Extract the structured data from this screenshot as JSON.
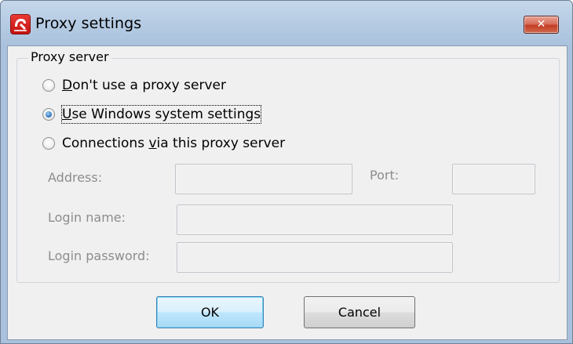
{
  "window": {
    "title": "Proxy settings",
    "close_glyph": "✕",
    "app_icon": "avira-umbrella-icon"
  },
  "group": {
    "legend": "Proxy server"
  },
  "options": {
    "no_proxy": {
      "mnemonic": "D",
      "rest": "on't use a proxy server",
      "checked": false
    },
    "windows_settings": {
      "mnemonic": "U",
      "rest": "se Windows system settings",
      "checked": true
    },
    "via_proxy": {
      "before": "Connections ",
      "mnemonic": "v",
      "rest": "ia this proxy server",
      "checked": false
    }
  },
  "fields": {
    "address_label": "Address:",
    "address_value": "",
    "port_label": "Port:",
    "port_value": "",
    "login_name_label": "Login name:",
    "login_name_value": "",
    "login_password_label": "Login password:",
    "login_password_value": ""
  },
  "buttons": {
    "ok": "OK",
    "cancel": "Cancel"
  },
  "colors": {
    "titlebar": "#b5cbe3",
    "client": "#f0f0f0",
    "disabled_text": "#8d8d8d",
    "close_button": "#c43c25",
    "default_button_border": "#3c7fb1"
  }
}
